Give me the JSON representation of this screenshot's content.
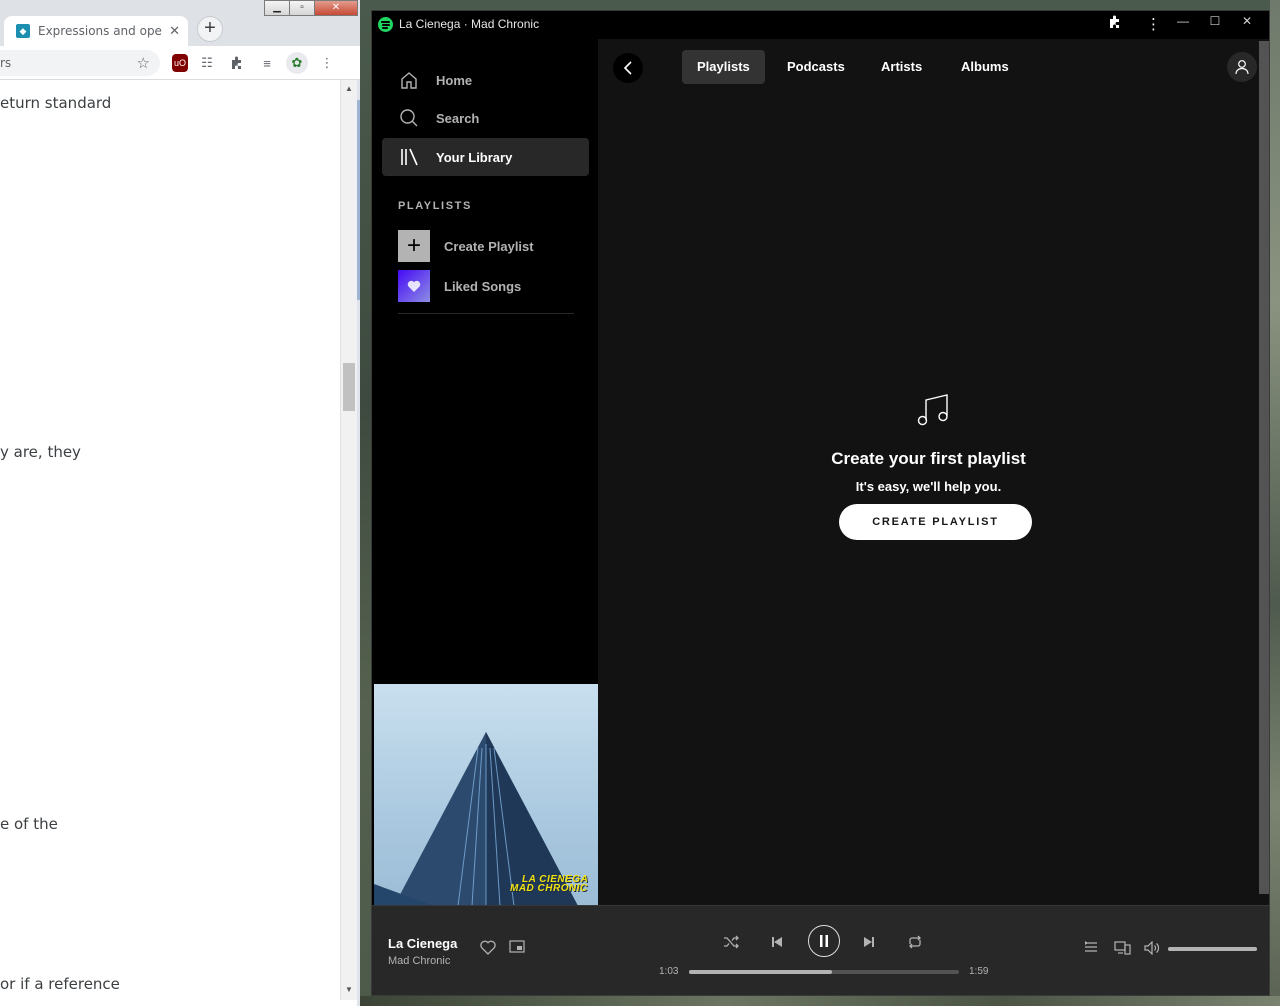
{
  "browser": {
    "tab_title": "Expressions and operato",
    "tab_close": "✕",
    "new_tab": "+",
    "omnibox_text": "rs",
    "page_lines": [
      "eturn standard",
      "y are, they",
      "e of the",
      "or if a reference"
    ]
  },
  "spotify": {
    "window_title": "La Cienega · Mad Chronic",
    "sidebar": {
      "nav": [
        {
          "label": "Home",
          "icon": "home-icon"
        },
        {
          "label": "Search",
          "icon": "search-icon"
        },
        {
          "label": "Your Library",
          "icon": "library-icon",
          "active": true
        }
      ],
      "playlists_heading": "PLAYLISTS",
      "playlists": [
        {
          "label": "Create Playlist",
          "icon": "plus-icon"
        },
        {
          "label": "Liked Songs",
          "icon": "heart-icon"
        }
      ],
      "cover_text": [
        "LA CIENEGA",
        "MAD CHRONIC"
      ]
    },
    "main": {
      "tabs": [
        {
          "label": "Playlists",
          "active": true
        },
        {
          "label": "Podcasts"
        },
        {
          "label": "Artists"
        },
        {
          "label": "Albums"
        }
      ],
      "empty_title": "Create your first playlist",
      "empty_subtitle": "It's easy, we'll help you.",
      "create_button": "CREATE PLAYLIST"
    },
    "player": {
      "track_title": "La Cienega",
      "track_artist": "Mad Chronic",
      "elapsed": "1:03",
      "duration": "1:59",
      "progress_fraction": 0.53,
      "volume_fraction": 1.0
    },
    "colors": {
      "accent": "#1ed760",
      "background": "#121212",
      "sidebar": "#000000",
      "player": "#282828"
    }
  }
}
